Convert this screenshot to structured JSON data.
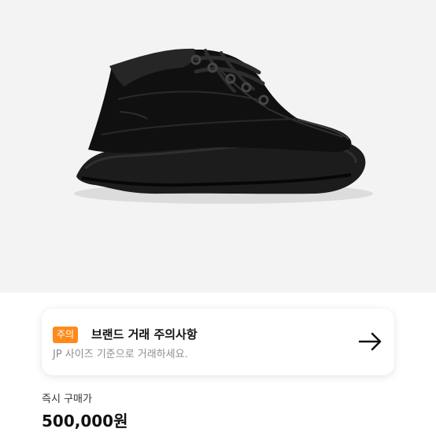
{
  "product": {
    "image_icon": "black-platform-sneaker-photo",
    "image_background": "#f3f3f3"
  },
  "notice": {
    "badge": "주의",
    "title": "브랜드 거래 주의사항",
    "description": "JP 사이즈 기준으로 거래하세요.",
    "arrow_icon": "arrow-right-icon",
    "badge_color": "#ff8a1c"
  },
  "price": {
    "label": "즉시 구매가",
    "value": "500,000원"
  }
}
